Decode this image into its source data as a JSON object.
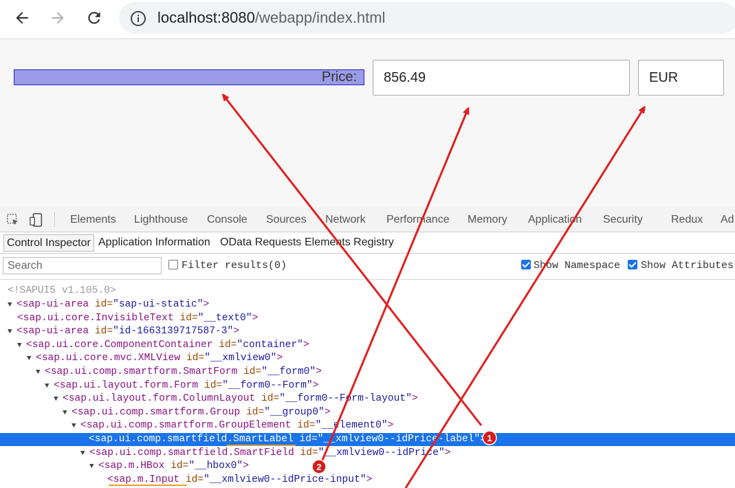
{
  "browser": {
    "url_host": "localhost:8080",
    "url_path": "/webapp/index.html"
  },
  "app": {
    "price_label": "Price:",
    "price_value": "856.49",
    "currency_value": "EUR"
  },
  "devtools": {
    "tabs": [
      "Elements",
      "Lighthouse",
      "Console",
      "Sources",
      "Network",
      "Performance",
      "Memory",
      "Application",
      "Security",
      "Redux",
      "Ad"
    ],
    "sub_tabs": [
      "Control Inspector",
      "Application Information",
      "OData Requests",
      "Elements Registry"
    ],
    "search_placeholder": "Search",
    "filter_label": "Filter results(0)",
    "show_namespace_label": "Show Namespace",
    "show_attributes_label": "Show Attributes",
    "version_comment": "<!SAPUI5 v1.105.0>",
    "tree": [
      {
        "caret": "▼",
        "tag": "<sap-ui-area",
        "attr": " id=",
        "val": "\"sap-ui-static\"",
        "end": ">"
      },
      {
        "caret": "",
        "tag": "<sap.ui.core.InvisibleText",
        "attr": " id=",
        "val": "\"__text0\"",
        "end": ">"
      },
      {
        "caret": "▼",
        "tag": "<sap-ui-area",
        "attr": " id=",
        "val": "\"id-1663139717587-3\"",
        "end": ">"
      },
      {
        "caret": "▼",
        "tag": "<sap.ui.core.ComponentContainer",
        "attr": " id=",
        "val": "\"container\"",
        "end": ">"
      },
      {
        "caret": "▼",
        "tag": "<sap.ui.core.mvc.XMLView",
        "attr": " id=",
        "val": "\"__xmlview0\"",
        "end": ">"
      },
      {
        "caret": "▼",
        "tag": "<sap.ui.comp.smartform.SmartForm",
        "attr": " id=",
        "val": "\"__form0\"",
        "end": ">"
      },
      {
        "caret": "▼",
        "tag": "<sap.ui.layout.form.Form",
        "attr": " id=",
        "val": "\"__form0--Form\"",
        "end": ">"
      },
      {
        "caret": "▼",
        "tag": "<sap.ui.layout.form.ColumnLayout",
        "attr": " id=",
        "val": "\"__form0--Form-layout\"",
        "end": ">"
      },
      {
        "caret": "▼",
        "tag": "<sap.ui.comp.smartform.Group",
        "attr": " id=",
        "val": "\"__group0\"",
        "end": ">"
      },
      {
        "caret": "▼",
        "tag": "<sap.ui.comp.smartform.GroupElement",
        "attr": " id=",
        "val": "\"__element0\"",
        "end": ">"
      },
      {
        "caret": "",
        "tag": "<sap.ui.comp.smartfield.SmartLabel",
        "attr": " id=",
        "val": "\"__xmlview0--idPrice-label\"",
        "end": ">"
      },
      {
        "caret": "▼",
        "tag": "<sap.ui.comp.smartfield.SmartField",
        "attr": " id=",
        "val": "\"__xmlview0--idPrice\"",
        "end": ">"
      },
      {
        "caret": "▼",
        "tag": "<sap.m.HBox",
        "attr": " id=",
        "val": "\"__hbox0\"",
        "end": ">"
      },
      {
        "caret": "",
        "tag": "<sap.m.Input",
        "attr": " id=",
        "val": "\"__xmlview0--idPrice-input\"",
        "end": ">"
      }
    ]
  },
  "annotations": {
    "badge_1": "1",
    "badge_2": "2",
    "arrow_color": "#e02020",
    "underline_color": "#f0a030"
  }
}
